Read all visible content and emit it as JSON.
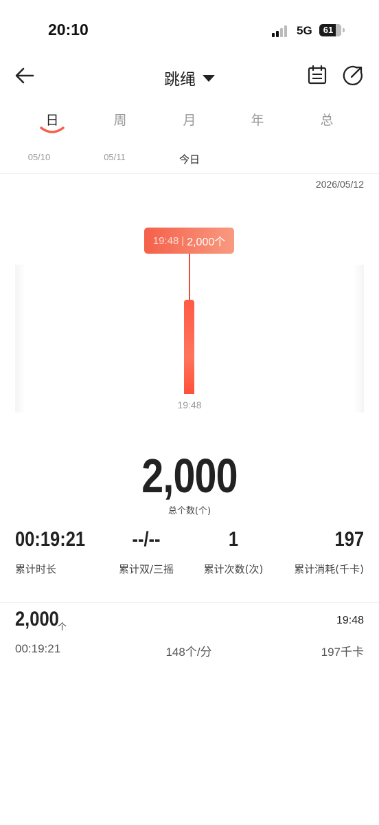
{
  "status_bar": {
    "time": "20:10",
    "network": "5G",
    "battery": "61"
  },
  "nav": {
    "title": "跳绳"
  },
  "period_tabs": [
    "日",
    "周",
    "月",
    "年",
    "总"
  ],
  "active_period": "日",
  "date_tabs": [
    "05/10",
    "05/11",
    "今日"
  ],
  "selected_date": "2026/05/12",
  "chart_data": {
    "type": "bar",
    "categories": [
      "19:48"
    ],
    "values": [
      2000
    ],
    "tooltip": {
      "time": "19:48",
      "value": "2,000个"
    }
  },
  "total": {
    "value": "2,000",
    "label": "总个数(个)"
  },
  "stats": [
    {
      "value": "00:19:21",
      "label": "累计时长"
    },
    {
      "value": "--/--",
      "label": "累计双/三摇"
    },
    {
      "value": "1",
      "label": "累计次数(次)"
    },
    {
      "value": "197",
      "label": "累计消耗(千卡)"
    }
  ],
  "record": {
    "count": "2,000",
    "unit": "个",
    "time": "19:48",
    "duration": "00:19:21",
    "pace": "148个/分",
    "calories": "197千卡"
  },
  "colors": {
    "accent": "#f5604a",
    "bar": "#ff5a45"
  }
}
